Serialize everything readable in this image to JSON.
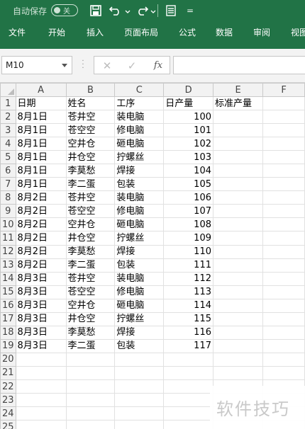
{
  "quick_access": {
    "autosave_label": "自动保存",
    "autosave_state": "关",
    "customize_glyph": "="
  },
  "ribbon": {
    "tabs": [
      "文件",
      "开始",
      "插入",
      "页面布局",
      "公式",
      "数据",
      "审阅",
      "视图"
    ]
  },
  "formula_bar": {
    "name_box": "M10",
    "fx_label": "fx",
    "formula": ""
  },
  "sheet": {
    "columns": [
      "A",
      "B",
      "C",
      "D",
      "E",
      "F"
    ],
    "header_row": [
      "日期",
      "姓名",
      "工序",
      "日产量",
      "标准产量",
      ""
    ],
    "rows": [
      [
        "8月1日",
        "苍井空",
        "装电脑",
        "100"
      ],
      [
        "8月1日",
        "苍空空",
        "修电脑",
        "101"
      ],
      [
        "8月1日",
        "空井仓",
        "砸电脑",
        "102"
      ],
      [
        "8月1日",
        "井仓空",
        "拧螺丝",
        "103"
      ],
      [
        "8月1日",
        "李莫愁",
        "焊接",
        "104"
      ],
      [
        "8月1日",
        "李二蛋",
        "包装",
        "105"
      ],
      [
        "8月2日",
        "苍井空",
        "装电脑",
        "106"
      ],
      [
        "8月2日",
        "苍空空",
        "修电脑",
        "107"
      ],
      [
        "8月2日",
        "空井仓",
        "砸电脑",
        "108"
      ],
      [
        "8月2日",
        "井仓空",
        "拧螺丝",
        "109"
      ],
      [
        "8月2日",
        "李莫愁",
        "焊接",
        "110"
      ],
      [
        "8月2日",
        "李二蛋",
        "包装",
        "111"
      ],
      [
        "8月3日",
        "苍井空",
        "装电脑",
        "112"
      ],
      [
        "8月3日",
        "苍空空",
        "修电脑",
        "113"
      ],
      [
        "8月3日",
        "空井仓",
        "砸电脑",
        "114"
      ],
      [
        "8月3日",
        "井仓空",
        "拧螺丝",
        "115"
      ],
      [
        "8月3日",
        "李莫愁",
        "焊接",
        "116"
      ],
      [
        "8月3日",
        "李二蛋",
        "包装",
        "117"
      ]
    ],
    "row_numbers": [
      "1",
      "2",
      "3",
      "4",
      "5",
      "6",
      "7",
      "8",
      "9",
      "10",
      "11",
      "12",
      "13",
      "14",
      "15",
      "16",
      "17",
      "18",
      "19",
      "20",
      "21",
      "22",
      "23",
      "24",
      "25"
    ]
  },
  "watermark": "软件技巧",
  "colors": {
    "ribbon": "#217346",
    "grid_line": "#e1e1e1",
    "header_bg": "#f2f2f2"
  }
}
